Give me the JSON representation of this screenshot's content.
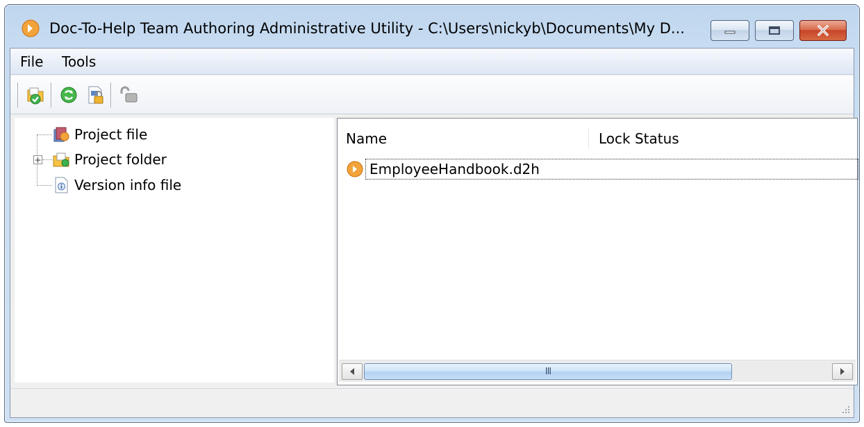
{
  "window": {
    "title": "Doc-To-Help Team Authoring Administrative Utility - C:\\Users\\nickyb\\Documents\\My D...",
    "app_icon": "doc-to-help-icon",
    "controls": [
      "minimize-icon",
      "maximize-icon",
      "close-icon"
    ]
  },
  "menu": {
    "file": "File",
    "tools": "Tools"
  },
  "toolbar": {
    "buttons": [
      "check-in-icon",
      "refresh-icon",
      "lock-file-icon",
      "unlock-icon"
    ]
  },
  "tree": {
    "items": [
      {
        "label": "Project file",
        "icon": "project-file-icon",
        "expandable": false
      },
      {
        "label": "Project folder",
        "icon": "project-folder-icon",
        "expandable": true,
        "expander": "+"
      },
      {
        "label": "Version info file",
        "icon": "version-info-icon",
        "expandable": false
      }
    ]
  },
  "list": {
    "columns": [
      "Name",
      "Lock Status"
    ],
    "rows": [
      {
        "name": "EmployeeHandbook.d2h",
        "lock_status": "",
        "icon": "d2h-file-icon"
      }
    ]
  },
  "scrollbar": {
    "thumb_grip": "III"
  },
  "colors": {
    "frame": "#c7dcf1",
    "close_button": "#c74428",
    "client_bg": "#f0f0f0",
    "scroll_thumb": "#b3d2f1"
  }
}
